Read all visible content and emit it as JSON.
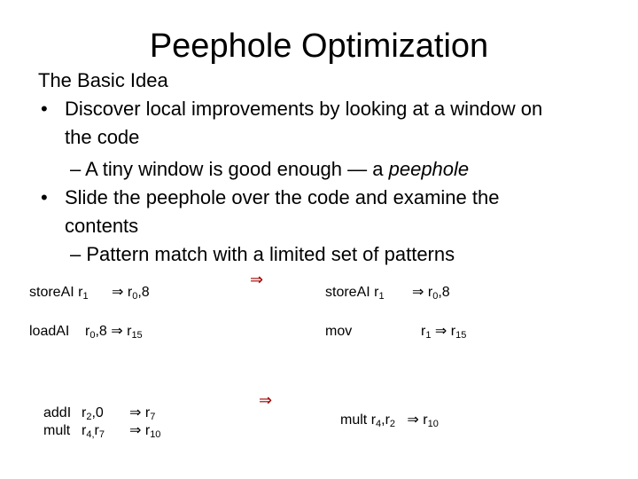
{
  "title": "Peephole Optimization",
  "heading": "The Basic Idea",
  "bullets": [
    {
      "marker": "•",
      "line1": "Discover local improvements by looking at a window on",
      "line2": "the code",
      "sub": {
        "marker": "–",
        "text": "A tiny window is good enough —  a ",
        "emph": "peephole"
      }
    },
    {
      "marker": "•",
      "line1": "Slide the peephole over the code and examine the",
      "line2": "contents",
      "sub": {
        "marker": "–",
        "text": "Pattern match with a limited set of patterns"
      }
    }
  ],
  "arrow_symbol": "⇒",
  "examples": [
    {
      "before": [
        {
          "op": "storeAI",
          "src": "r",
          "src_sub": "1",
          "dst": "r",
          "dst_sub": "0",
          "dst_suffix": ",8"
        },
        {
          "op": "loadAI",
          "src": "r",
          "src_sub": "0",
          "src_suffix": ",8",
          "dst": "r",
          "dst_sub": "15"
        }
      ],
      "after": [
        {
          "op": "storeAI",
          "src": "r",
          "src_sub": "1",
          "dst": "r",
          "dst_sub": "0",
          "dst_suffix": ",8"
        },
        {
          "op": "mov",
          "src": "r",
          "src_sub": "1",
          "dst": "r",
          "dst_sub": "15"
        }
      ]
    },
    {
      "before": [
        {
          "op": "addI",
          "src": "r",
          "src_sub": "2",
          "src_suffix": ",0",
          "dst": "r",
          "dst_sub": "7"
        },
        {
          "op": "mult",
          "src": "r",
          "src_sub": "4,",
          "src2": "r",
          "src2_sub": "7",
          "dst": "r",
          "dst_sub": "10"
        }
      ],
      "after": [
        {
          "op": "mult",
          "src": "r",
          "src_sub": "4",
          "src2": ",r",
          "src2_sub": "2",
          "dst": "r",
          "dst_sub": "10"
        }
      ]
    }
  ],
  "colors": {
    "transform_arrow": "#a00000",
    "text": "#000000",
    "background": "#ffffff"
  }
}
